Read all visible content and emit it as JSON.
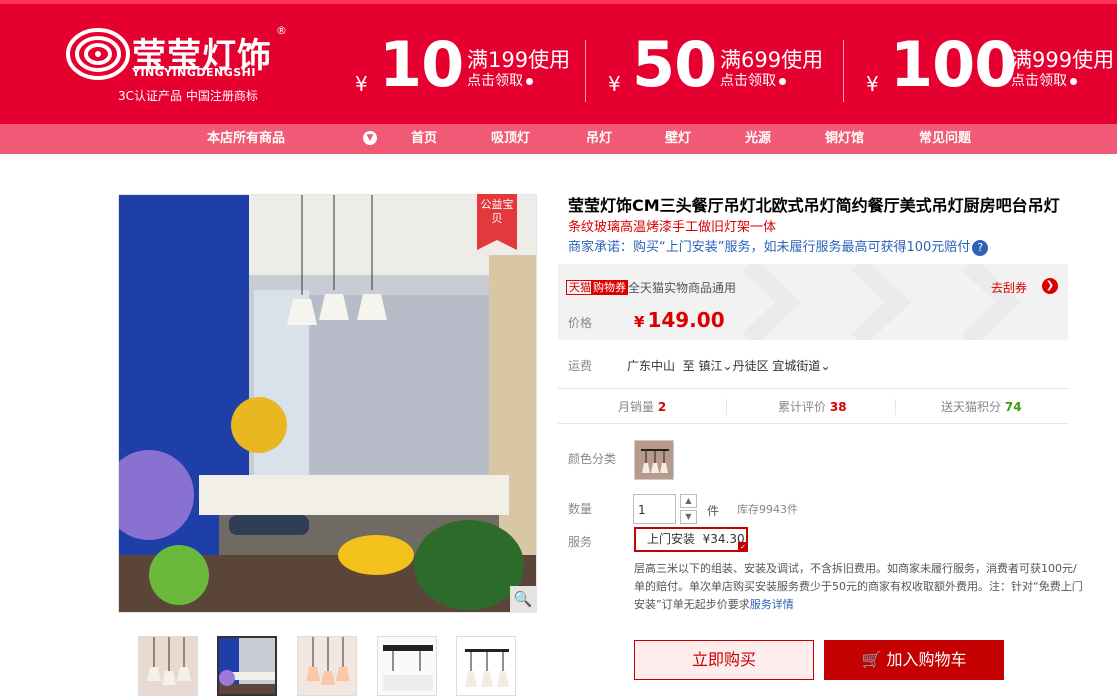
{
  "colors": {
    "banner_bg": "#e60030",
    "nav_bg": "#f05a76",
    "price_red": "#db0000",
    "link_blue": "#2e63b8"
  },
  "header": {
    "logo": {
      "brand": "莹莹灯饰",
      "reg_mark": "®",
      "pinyin": "YINGYINGDENGSHI",
      "certification": "3C认证产品  中国注册商标"
    },
    "coupons": [
      {
        "currency": "¥",
        "amount": "10",
        "condition": "满199使用",
        "action": "点击领取"
      },
      {
        "currency": "¥",
        "amount": "50",
        "condition": "满699使用",
        "action": "点击领取"
      },
      {
        "currency": "¥",
        "amount": "100",
        "condition": "满999使用",
        "action": "点击领取"
      }
    ]
  },
  "nav": {
    "all_products": "本店所有商品",
    "items": [
      "首页",
      "吸顶灯",
      "吊灯",
      "壁灯",
      "光源",
      "铜灯馆",
      "常见问题"
    ]
  },
  "gallery": {
    "ribbon": "公益宝贝",
    "zoom_icon": "magnifier-icon",
    "thumbnail_count": 5,
    "active_thumbnail": 2
  },
  "product": {
    "title": "莹莹灯饰CM三头餐厅吊灯北欧式吊灯简约餐厅美式吊灯厨房吧台吊灯",
    "subtitle": "条纹玻璃高温烤漆手工做旧灯架一体",
    "promise": "商家承诺：购买“上门安装”服务，如未履行服务最高可获得100元赔付",
    "promise_help": "?"
  },
  "pricebox": {
    "tmall_tag": "天猫",
    "coupon_tag": "购物券",
    "coupon_text": "全天猫实物商品通用",
    "get_coupon": "去刮券",
    "price_label": "价格",
    "currency": "¥",
    "price": "149.00"
  },
  "shipping": {
    "label": "运费",
    "origin": "广东中山",
    "to": "至",
    "city": "镇江",
    "district": "丹徒区",
    "street": "宜城街道"
  },
  "stats": {
    "monthly_sales_label": "月销量",
    "monthly_sales": "2",
    "reviews_label": "累计评价",
    "reviews": "38",
    "points_label": "送天猫积分",
    "points": "74"
  },
  "color": {
    "label": "颜色分类"
  },
  "quantity": {
    "label": "数量",
    "value": "1",
    "unit": "件",
    "stock": "库存9943件"
  },
  "service": {
    "label": "服务",
    "option": "上门安装",
    "option_price": "¥34.30",
    "description": "层高三米以下的组装、安装及调试，不含拆旧费用。如商家未履行服务，消费者可获100元/单的赔付。单次单店购买安装服务费少于50元的商家有权收取额外费用。注：针对“免费上门安装”订单无起步价要求",
    "details_link": "服务详情"
  },
  "actions": {
    "buy_now": "立即购买",
    "add_to_cart": "加入购物车",
    "cart_icon": "cart-icon"
  }
}
